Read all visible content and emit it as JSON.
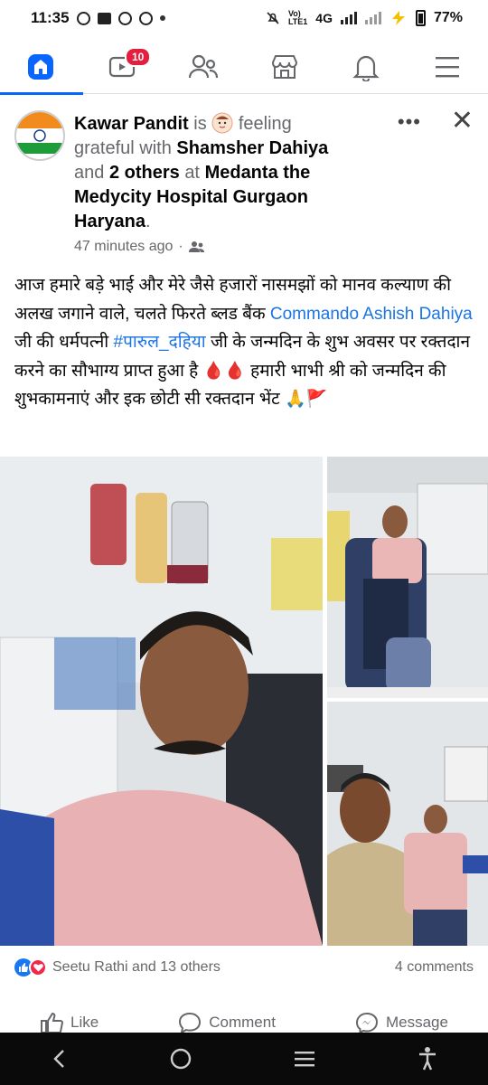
{
  "status_bar": {
    "time": "11:35",
    "network": "4G",
    "battery": "77%"
  },
  "nav": {
    "tabs": [
      "home",
      "video",
      "friends",
      "marketplace",
      "notifications",
      "menu"
    ],
    "video_badge": "10"
  },
  "post": {
    "author": "Kawar Pandit",
    "is_text": "is",
    "feeling_text": "feeling grateful with",
    "tagged": "Shamsher Dahiya",
    "and_text": "and",
    "others": "2 others",
    "at_text": "at",
    "location": "Medanta the Medycity Hospital Gurgaon Haryana",
    "time": "47 minutes ago",
    "dot_sep": "·",
    "body_1": "आज हमारे बड़े भाई और मेरे जैसे हजारों नासमझों को मानव कल्याण की अलख जगाने वाले, चलते फिरते ब्लड बैंक",
    "mention": "Commando Ashish Dahiya",
    "body_2": "जी की धर्मपत्नी",
    "hashtag": "#पारुल_दहिया",
    "body_3": "जी के जन्मदिन के शुभ अवसर पर रक्तदान करने का सौभाग्य प्राप्त हुआ है 🩸🩸 हमारी भाभी श्री को जन्मदिन की शुभकामनाएं और इक छोटी सी रक्तदान भेंट 🙏🚩"
  },
  "reactions": {
    "text": "Seetu Rathi and 13 others",
    "comments": "4 comments"
  },
  "actions": {
    "like": "Like",
    "comment": "Comment",
    "message": "Message"
  },
  "colors": {
    "accent": "#0866ff",
    "link": "#1b74e4",
    "badge": "#e41e3f"
  }
}
